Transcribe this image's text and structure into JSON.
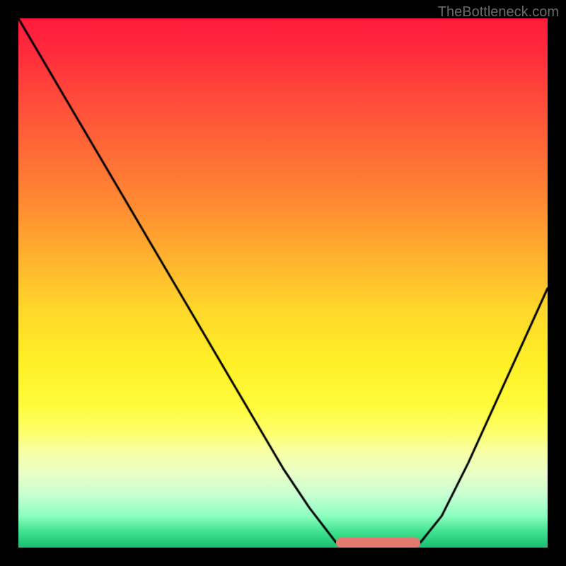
{
  "watermark": "TheBottleneck.com",
  "chart_data": {
    "type": "line",
    "title": "",
    "xlabel": "",
    "ylabel": "",
    "xlim": [
      0,
      1
    ],
    "ylim": [
      0,
      1
    ],
    "x": [
      0.0,
      0.05,
      0.1,
      0.15,
      0.2,
      0.25,
      0.3,
      0.35,
      0.4,
      0.45,
      0.5,
      0.55,
      0.6,
      0.63,
      0.67,
      0.7,
      0.73,
      0.76,
      0.8,
      0.85,
      0.9,
      0.95,
      1.0
    ],
    "y": [
      1.0,
      0.915,
      0.83,
      0.745,
      0.66,
      0.575,
      0.49,
      0.405,
      0.32,
      0.235,
      0.15,
      0.075,
      0.01,
      0.0,
      0.0,
      0.0,
      0.0,
      0.01,
      0.06,
      0.16,
      0.27,
      0.38,
      0.49
    ],
    "highlight_x_range": [
      0.6,
      0.76
    ],
    "background_gradient": {
      "top": "#ff1a3c",
      "mid": "#fff026",
      "bottom": "#18c070"
    },
    "highlight_color": "#e27a70",
    "curve_color": "#000000"
  }
}
